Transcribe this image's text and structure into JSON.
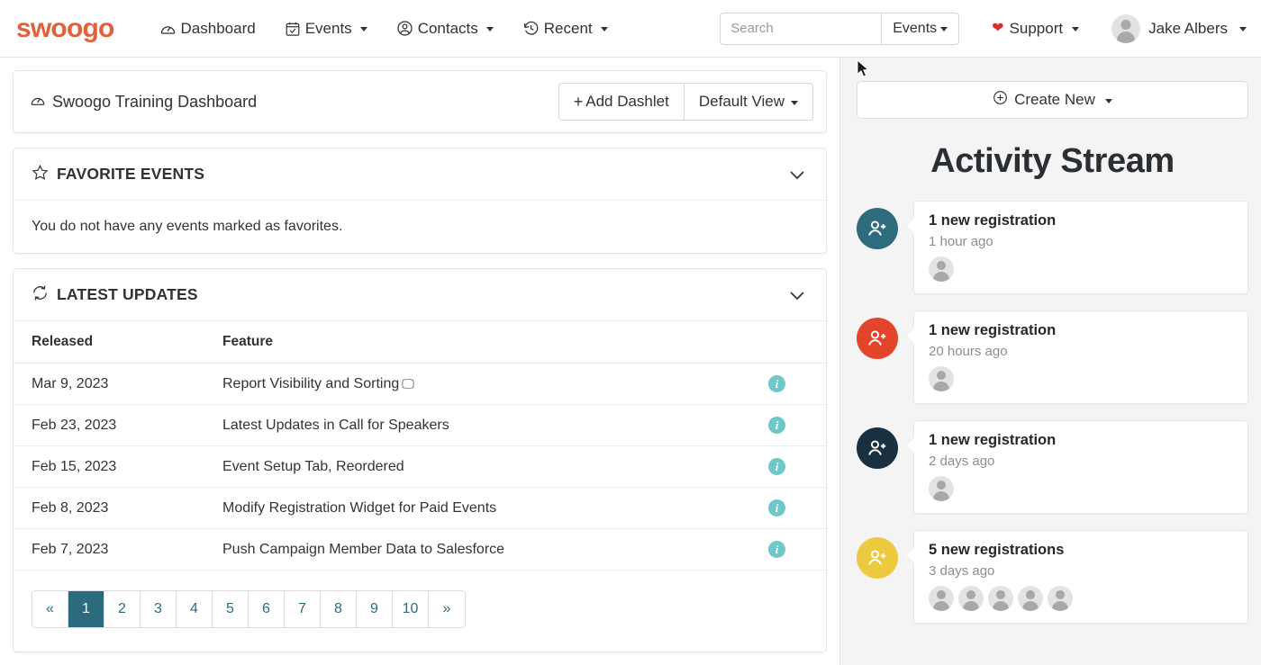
{
  "nav": {
    "logo": "swoogo",
    "items": [
      {
        "label": "Dashboard",
        "icon": "gauge-icon",
        "has_caret": false
      },
      {
        "label": "Events",
        "icon": "calendar-check-icon",
        "has_caret": true
      },
      {
        "label": "Contacts",
        "icon": "user-circle-icon",
        "has_caret": true
      },
      {
        "label": "Recent",
        "icon": "clock-rewind-icon",
        "has_caret": true
      }
    ],
    "search": {
      "placeholder": "Search",
      "value": "",
      "scope_label": "Events"
    },
    "support_label": "Support",
    "user_name": "Jake Albers"
  },
  "dashboard": {
    "title": "Swoogo Training Dashboard",
    "add_dashlet_label": "Add Dashlet",
    "add_dashlet_plus": "+",
    "view_label": "Default View"
  },
  "favorites": {
    "title": "FAVORITE EVENTS",
    "empty_text": "You do not have any events marked as favorites."
  },
  "latest_updates": {
    "title": "LATEST UPDATES",
    "columns": [
      "Released",
      "Feature"
    ],
    "rows": [
      {
        "released": "Mar 9, 2023",
        "feature": "Report Visibility and Sorting",
        "glyph": "🖵",
        "info": "i"
      },
      {
        "released": "Feb 23, 2023",
        "feature": "Latest Updates in Call for Speakers",
        "glyph": "",
        "info": "i"
      },
      {
        "released": "Feb 15, 2023",
        "feature": "Event Setup Tab, Reordered",
        "glyph": "",
        "info": "i"
      },
      {
        "released": "Feb 8, 2023",
        "feature": "Modify Registration Widget for Paid Events",
        "glyph": "",
        "info": "i"
      },
      {
        "released": "Feb 7, 2023",
        "feature": "Push Campaign Member Data to Salesforce",
        "glyph": "",
        "info": "i"
      }
    ],
    "pagination": {
      "prev": "«",
      "next": "»",
      "pages": [
        "1",
        "2",
        "3",
        "4",
        "5",
        "6",
        "7",
        "8",
        "9",
        "10"
      ],
      "current": "1"
    }
  },
  "activity": {
    "create_new_label": "Create New",
    "stream_title": "Activity Stream",
    "items": [
      {
        "headline": "1 new registration",
        "time": "1 hour ago",
        "badge_color": "#2d6b7d",
        "avatars": 1
      },
      {
        "headline": "1 new registration",
        "time": "20 hours ago",
        "badge_color": "#e2452a",
        "avatars": 1
      },
      {
        "headline": "1 new registration",
        "time": "2 days ago",
        "badge_color": "#18303f",
        "avatars": 1
      },
      {
        "headline": "5 new registrations",
        "time": "3 days ago",
        "badge_color": "#ecc93f",
        "avatars": 5
      }
    ]
  },
  "colors": {
    "brand_orange": "#e2613c",
    "teal": "#2c6b7d",
    "info_teal": "#6fc7c9",
    "panel_bg": "#f4f4f4"
  }
}
